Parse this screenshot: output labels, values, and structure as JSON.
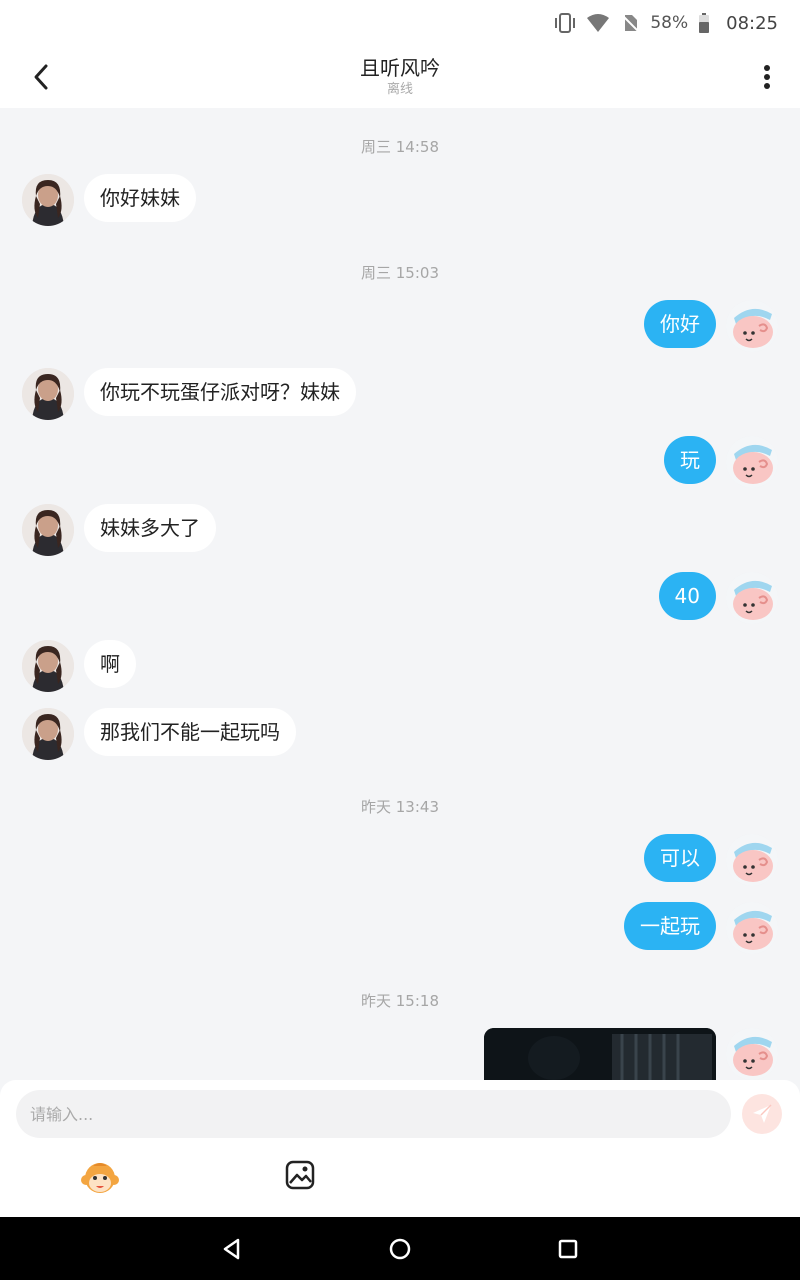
{
  "status_bar": {
    "battery": "58%",
    "time": "08:25"
  },
  "header": {
    "title": "且听风吟",
    "subtitle": "离线"
  },
  "messages": [
    {
      "timestamp": "周三 14:58"
    },
    {
      "from": "other",
      "text": "你好妹妹"
    },
    {
      "timestamp": "周三 15:03"
    },
    {
      "from": "me",
      "text": "你好"
    },
    {
      "from": "other",
      "text": "你玩不玩蛋仔派对呀？妹妹"
    },
    {
      "from": "me",
      "text": "玩"
    },
    {
      "from": "other",
      "text": "妹妹多大了"
    },
    {
      "from": "me",
      "text": "40"
    },
    {
      "from": "other",
      "text": "啊"
    },
    {
      "from": "other",
      "text": "那我们不能一起玩吗"
    },
    {
      "timestamp": "昨天 13:43"
    },
    {
      "from": "me",
      "text": "可以"
    },
    {
      "from": "me",
      "text": "一起玩"
    },
    {
      "timestamp": "昨天 15:18"
    }
  ],
  "input": {
    "placeholder": "请输入..."
  },
  "colors": {
    "bubble_out": "#2bb3f3",
    "bubble_in": "#ffffff",
    "background": "#f4f5f7"
  }
}
